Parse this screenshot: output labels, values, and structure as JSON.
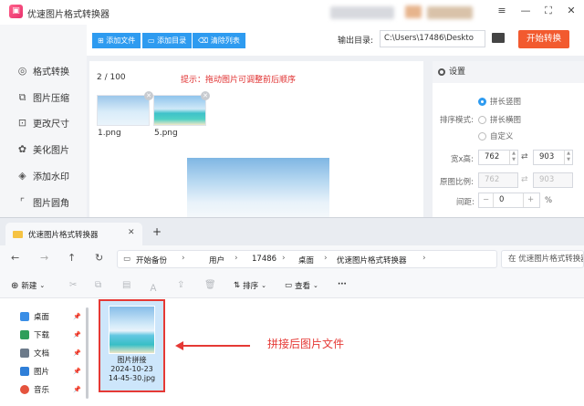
{
  "app": {
    "title": "优速图片格式转换器",
    "sidebar": [
      {
        "icon": "format-convert-icon",
        "label": "格式转换"
      },
      {
        "icon": "image-compress-icon",
        "label": "图片压缩"
      },
      {
        "icon": "resize-icon",
        "label": "更改尺寸"
      },
      {
        "icon": "beautify-icon",
        "label": "美化图片"
      },
      {
        "icon": "watermark-icon",
        "label": "添加水印"
      },
      {
        "icon": "round-corner-icon",
        "label": "图片圆角"
      }
    ],
    "toolbar": {
      "add_file": "添加文件",
      "add_folder": "添加目录",
      "clear_list": "清除列表",
      "output_label": "输出目录:",
      "output_path": "C:\\Users\\17486\\Deskto",
      "start": "开始转换"
    },
    "work": {
      "count": "2 / 100",
      "tip": "提示：拖动图片可调整前后顺序",
      "files": [
        "1.png",
        "5.png"
      ]
    },
    "settings": {
      "title": "设置",
      "order_label": "排序模式:",
      "options": [
        "拼长竖图",
        "拼长横图",
        "自定义"
      ],
      "selected": "拼长竖图",
      "wh_label": "宽x高:",
      "width": "762",
      "height": "903",
      "ratio_label": "原图比例:",
      "ratio_w": "762",
      "ratio_h": "903",
      "gap_label": "间距:",
      "gap_value": "0",
      "gap_unit": "%"
    }
  },
  "explorer": {
    "tab_title": "优速图片格式转换器",
    "breadcrumbs": [
      "开始备份",
      "用户",
      "17486",
      "桌面",
      "优速图片格式转换器"
    ],
    "search_placeholder": "在 优速图片格式转换器 中搜索",
    "commands": {
      "new": "新建",
      "sort": "排序",
      "view": "查看",
      "more": "···"
    },
    "nav_items": [
      {
        "label": "桌面",
        "color": "#3a8ee6"
      },
      {
        "label": "下载",
        "color": "#2f9e5a"
      },
      {
        "label": "文档",
        "color": "#6c7a8a"
      },
      {
        "label": "图片",
        "color": "#2f7fd8"
      },
      {
        "label": "音乐",
        "color": "#e5533d"
      }
    ],
    "file": {
      "name": "图片拼接\n2024-10-23\n14-45-30.jpg"
    }
  },
  "annotation": "拼接后图片文件",
  "colors": {
    "accent_blue": "#2e9bf0",
    "start_orange": "#f25a2f",
    "highlight_red": "#e53935"
  }
}
